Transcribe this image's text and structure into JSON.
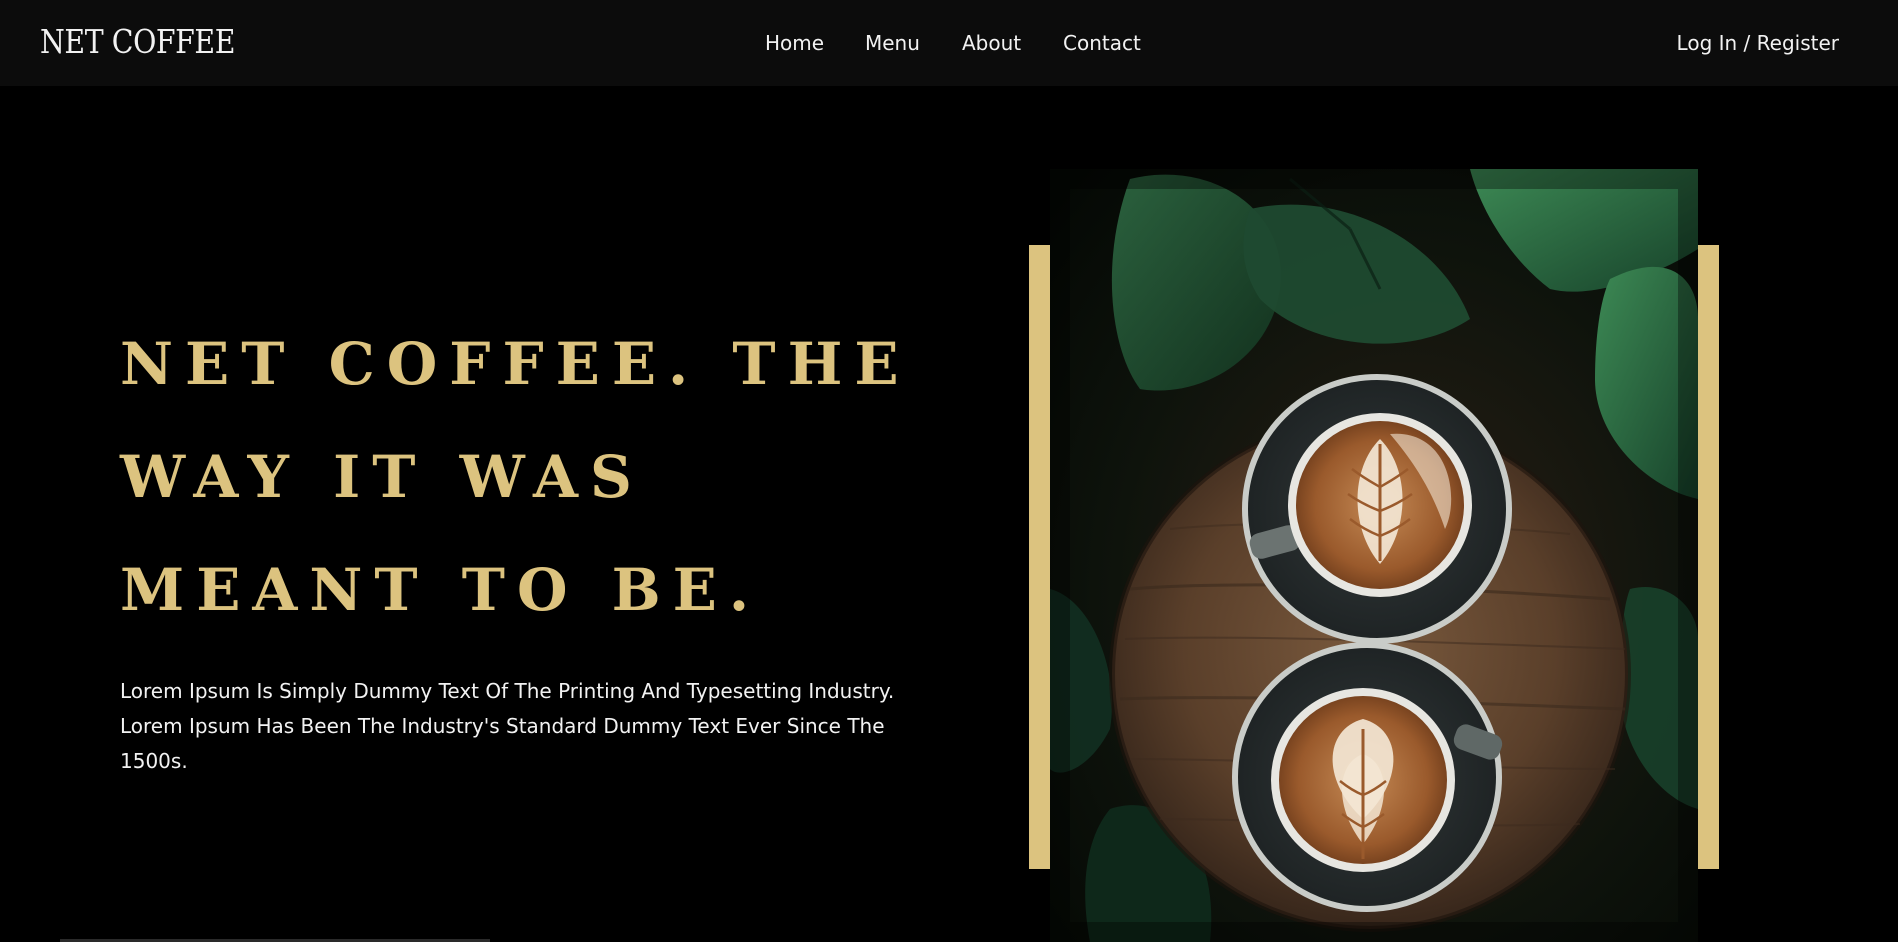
{
  "brand": {
    "name": "NET COFFEE"
  },
  "nav": {
    "items": [
      {
        "label": "Home"
      },
      {
        "label": "Menu"
      },
      {
        "label": "About"
      },
      {
        "label": "Contact"
      }
    ],
    "login_label": "Log In / Register"
  },
  "hero": {
    "headline_lines": [
      "NET COFFEE. THE",
      "WAY IT WAS",
      "MEANT TO BE."
    ],
    "description_lines": [
      "Lorem Ipsum Is Simply Dummy Text Of The Printing And Typesetting Industry.",
      "Lorem Ipsum Has Been The Industry's Standard Dummy Text Ever Since The",
      "1500s."
    ],
    "image_subject": "two-latte-art-cups-on-wooden-table-with-plants"
  },
  "colors": {
    "background": "#000000",
    "navbar": "#0c0c0c",
    "accent_gold": "#dcc37f",
    "text_light": "#f2f2f2"
  }
}
